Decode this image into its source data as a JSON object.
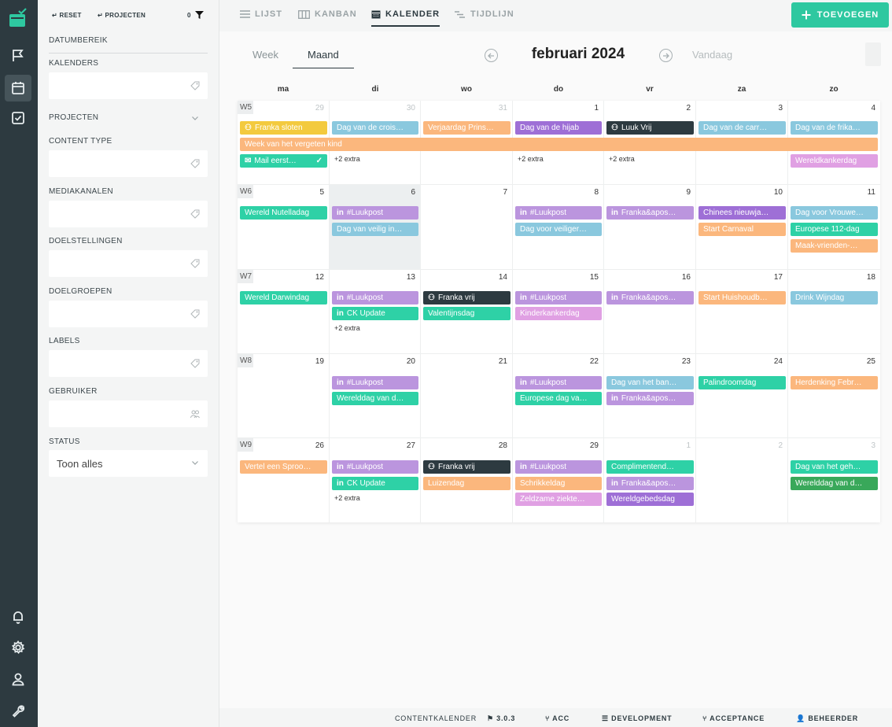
{
  "sidebar_nav": [
    "flag-icon",
    "calendar-icon",
    "checkbox-icon",
    "bell-icon",
    "gear-icon",
    "user-icon",
    "wrench-icon"
  ],
  "filters": {
    "reset_label": "RESET",
    "projects_label": "PROJECTEN",
    "filter_count": "0",
    "sections": {
      "date_range": "DATUMBEREIK",
      "calendars": "KALENDERS",
      "projects": "PROJECTEN",
      "content_type": "CONTENT TYPE",
      "media_channels": "MEDIAKANALEN",
      "goals": "DOELSTELLINGEN",
      "target_groups": "DOELGROEPEN",
      "labels": "LABELS",
      "user": "GEBRUIKER",
      "status": "STATUS"
    },
    "status_value": "Toon alles"
  },
  "view_tabs": [
    "LIJST",
    "KANBAN",
    "KALENDER",
    "TIJDLIJN"
  ],
  "add_button": "TOEVOEGEN",
  "calendar": {
    "sub_tabs": [
      "Week",
      "Maand"
    ],
    "month_title": "februari 2024",
    "today_label": "Vandaag",
    "weekdays": [
      "ma",
      "di",
      "wo",
      "do",
      "vr",
      "za",
      "zo"
    ],
    "weeks": [
      {
        "label": "W5",
        "days": [
          "29",
          "30",
          "31",
          "1",
          "2",
          "3",
          "4"
        ]
      },
      {
        "label": "W6",
        "days": [
          "5",
          "6",
          "7",
          "8",
          "9",
          "10",
          "11"
        ]
      },
      {
        "label": "W7",
        "days": [
          "12",
          "13",
          "14",
          "15",
          "16",
          "17",
          "18"
        ]
      },
      {
        "label": "W8",
        "days": [
          "19",
          "20",
          "21",
          "22",
          "23",
          "24",
          "25"
        ]
      },
      {
        "label": "W9",
        "days": [
          "26",
          "27",
          "28",
          "29",
          "1",
          "2",
          "3"
        ]
      }
    ],
    "extra_label": "+2 extra",
    "events": {
      "w5_mo": "Franka sloten",
      "w5_tu": "Dag van de crois…",
      "w5_we": "Verjaardag Prins…",
      "w5_th": "Dag van de hijab",
      "w5_fr": "Luuk Vrij",
      "w5_sa": "Dag van de carr…",
      "w5_su": "Dag van de frika…",
      "w5_span": "Week van het vergeten kind",
      "w5_mail": "Mail eerst…",
      "w5_su2": "Wereldkankerdag",
      "w6_mo": "Wereld Nutelladag",
      "w6_tu1": "#Luukpost",
      "w6_tu2": "Dag van veilig in…",
      "w6_th1": "#Luukpost",
      "w6_th2": "Dag voor veiliger…",
      "w6_fr1": "Franka&apos…",
      "w6_sa1": "Chinees nieuwja…",
      "w6_sa2": "Start Carnaval",
      "w6_su1": "Dag voor Vrouwe…",
      "w6_su2": "Europese 112-dag",
      "w6_su3": "Maak-vrienden-…",
      "w7_mo": "Wereld Darwindag",
      "w7_tu1": "#Luukpost",
      "w7_tu2": "CK Update",
      "w7_we1": "Franka vrij",
      "w7_we2": "Valentijnsdag",
      "w7_th1": "#Luukpost",
      "w7_th2": "Kinderkankerdag",
      "w7_fr1": "Franka&apos…",
      "w7_sa1": "Start Huishoudb…",
      "w7_su1": "Drink Wijndag",
      "w8_tu1": "#Luukpost",
      "w8_tu2": "Werelddag van d…",
      "w8_th1": "#Luukpost",
      "w8_th2": "Europese dag va…",
      "w8_fr1": "Dag van het ban…",
      "w8_fr2": "Franka&apos…",
      "w8_sa1": "Palindroomdag",
      "w8_su1": "Herdenking Febr…",
      "w9_mo": "Vertel een Sproo…",
      "w9_tu1": "#Luukpost",
      "w9_tu2": "CK Update",
      "w9_we1": "Franka vrij",
      "w9_we2": "Luizendag",
      "w9_th1": "#Luukpost",
      "w9_th2": "Schrikkeldag",
      "w9_th3": "Zeldzame ziekte…",
      "w9_fr1": "Complimentend…",
      "w9_fr2": "Franka&apos…",
      "w9_fr3": "Wereldgebedsdag",
      "w9_su1": "Dag van het geh…",
      "w9_su2": "Werelddag van d…"
    }
  },
  "footer": {
    "app": "CONTENTKALENDER",
    "version": "3.0.3",
    "acc": "ACC",
    "development": "DEVELOPMENT",
    "acceptance": "ACCEPTANCE",
    "admin": "BEHEERDER"
  },
  "colors": {
    "accent": "#2ec8a0",
    "rail": "#2d3a40"
  }
}
